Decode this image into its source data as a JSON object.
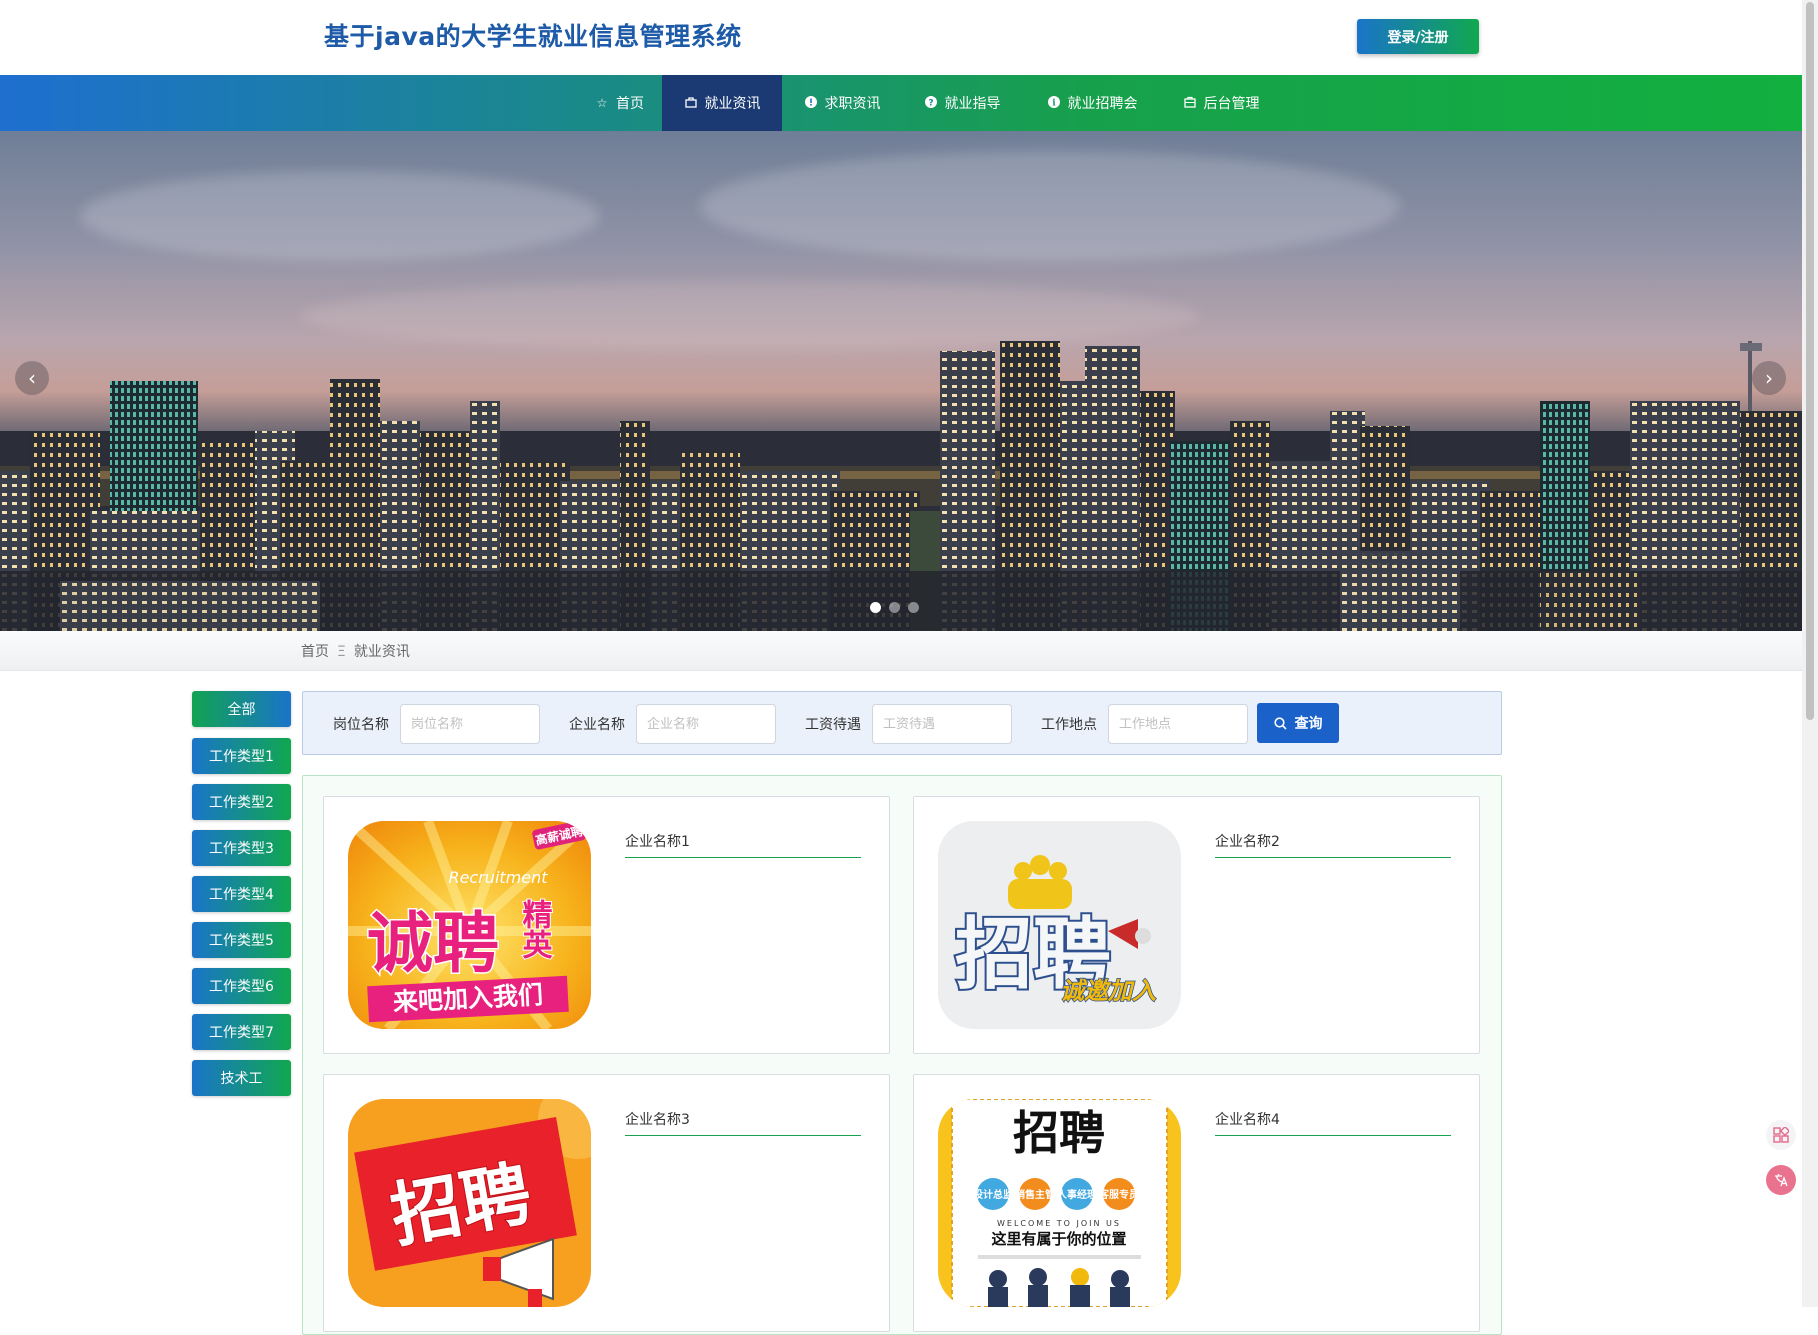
{
  "header": {
    "site_title": "基于java的大学生就业信息管理系统",
    "login_label": "登录/注册"
  },
  "nav": {
    "items": [
      {
        "label": "首页",
        "icon": "star-icon"
      },
      {
        "label": "就业资讯",
        "icon": "bag-icon",
        "active": true
      },
      {
        "label": "求职资讯",
        "icon": "info-icon"
      },
      {
        "label": "就业指导",
        "icon": "help-icon"
      },
      {
        "label": "就业招聘会",
        "icon": "info-icon"
      },
      {
        "label": "后台管理",
        "icon": "briefcase-icon"
      }
    ]
  },
  "banner": {
    "prev": "‹",
    "next": "›",
    "slides": 3,
    "active_slide": 1
  },
  "breadcrumb": {
    "home": "首页",
    "separator": "Ξ",
    "current": "就业资讯"
  },
  "sidebar": {
    "items": [
      "全部",
      "工作类型1",
      "工作类型2",
      "工作类型3",
      "工作类型4",
      "工作类型5",
      "工作类型6",
      "工作类型7",
      "技术工"
    ]
  },
  "search": {
    "fields": [
      {
        "label": "岗位名称",
        "placeholder": "岗位名称",
        "value": ""
      },
      {
        "label": "企业名称",
        "placeholder": "企业名称",
        "value": ""
      },
      {
        "label": "工资待遇",
        "placeholder": "工资待遇",
        "value": ""
      },
      {
        "label": "工作地点",
        "placeholder": "工作地点",
        "value": ""
      }
    ],
    "button_label": "查询"
  },
  "cards": [
    {
      "company": "企业名称1",
      "poster": {
        "line1": "诚聘",
        "line2": "精英",
        "line3": "来吧加入我们",
        "tag": "高薪诚聘",
        "en": "Recruitment"
      }
    },
    {
      "company": "企业名称2",
      "poster": {
        "line1": "招聘",
        "line2": "诚邀加入"
      }
    },
    {
      "company": "企业名称3",
      "poster": {
        "line1": "招聘"
      }
    },
    {
      "company": "企业名称4",
      "poster": {
        "line1": "招聘",
        "line2": "这里有属于你的位置",
        "en": "WELCOME TO JOIN US",
        "roles": [
          "设计总监",
          "销售主管",
          "人事经理",
          "客服专员"
        ]
      }
    }
  ],
  "colors": {
    "brand_blue": "#1d5aa8",
    "nav_active": "#1b3a74",
    "accent_green": "#10a84f",
    "query_blue": "#1a62c9"
  }
}
